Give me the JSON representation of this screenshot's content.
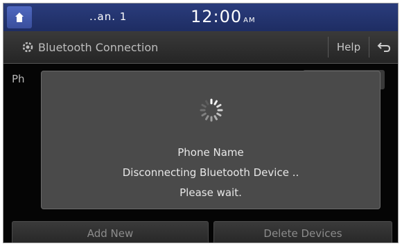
{
  "statusbar": {
    "home_icon": "home-icon",
    "signal_text": "..an.  1",
    "time": "12:00",
    "ampm": "AM"
  },
  "header": {
    "icon": "bluetooth-settings-icon",
    "title": "Bluetooth Connection",
    "help_label": "Help",
    "back_icon": "back-arrow-icon"
  },
  "background": {
    "list_label": "Ph"
  },
  "popup": {
    "icon": "loading-spinner-icon",
    "device_name": "Phone Name",
    "message": "Disconnecting Bluetooth Device ..",
    "wait_text": "Please wait."
  },
  "bottom_buttons": {
    "add_new": "Add New",
    "delete_devices": "Delete Devices"
  },
  "colors": {
    "statusbar_blue": "#24357a",
    "popup_gray": "#4a4a4a",
    "background": "#050505"
  }
}
